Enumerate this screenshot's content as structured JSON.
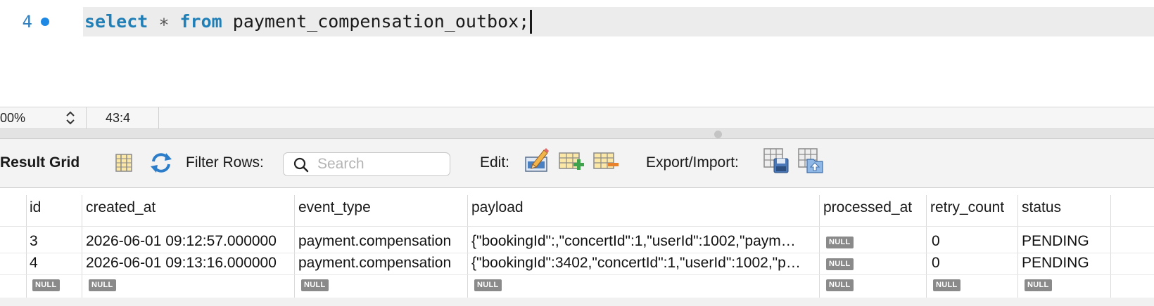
{
  "editor": {
    "line_number": "4",
    "code": {
      "kw_select": "select",
      "star": "∗",
      "kw_from": "from",
      "table": "payment_compensation_outbox",
      "semicolon": ";"
    }
  },
  "statusbar": {
    "zoom": "00%",
    "cursor_position": "43:4"
  },
  "toolbar": {
    "result_grid_label": "Result Grid",
    "filter_rows_label": "Filter Rows:",
    "search_placeholder": "Search",
    "edit_label": "Edit:",
    "export_import_label": "Export/Import:"
  },
  "grid": {
    "columns": [
      "id",
      "created_at",
      "event_type",
      "payload",
      "processed_at",
      "retry_count",
      "status"
    ],
    "null_label": "NULL",
    "rows": [
      {
        "id": "3",
        "created_at": "2026-06-01 09:12:57.000000",
        "event_type": "payment.compensation",
        "payload": "{\"bookingId\":,\"concertId\":1,\"userId\":1002,\"paym…",
        "retry_count": "0",
        "status": "PENDING"
      },
      {
        "id": "4",
        "created_at": "2026-06-01 09:13:16.000000",
        "event_type": "payment.compensation",
        "payload": "{\"bookingId\":3402,\"concertId\":1,\"userId\":1002,\"p…",
        "retry_count": "0",
        "status": "PENDING"
      }
    ]
  },
  "colors": {
    "keyword": "#1f7fb6",
    "line_number": "#2f7fc0",
    "breakpoint": "#1e88e5",
    "null_badge": "#8a8a8a"
  },
  "icons": [
    "breakpoint-dot-icon",
    "zoom-stepper-icon",
    "column-toggle-icon",
    "refresh-icon",
    "search-icon",
    "edit-row-icon",
    "add-row-icon",
    "delete-row-icon",
    "export-icon",
    "import-icon"
  ]
}
